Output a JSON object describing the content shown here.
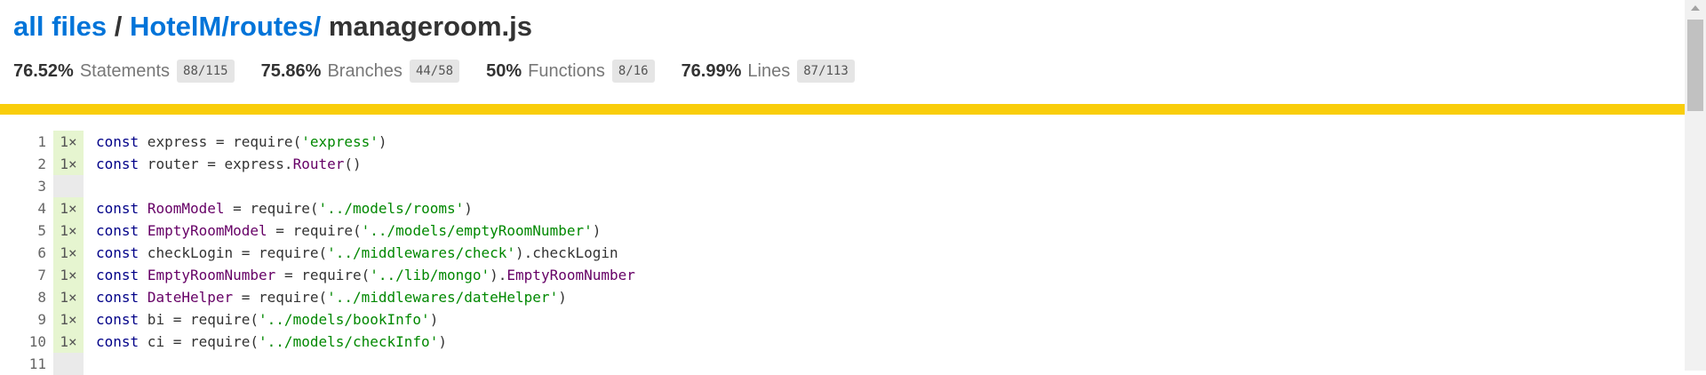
{
  "breadcrumb": {
    "all_files": "all files",
    "sep1": " / ",
    "dir": "HotelM/routes/",
    "file": " manageroom.js"
  },
  "stats": [
    {
      "pct": "76.52%",
      "label": "Statements",
      "frac": "88/115"
    },
    {
      "pct": "75.86%",
      "label": "Branches",
      "frac": "44/58"
    },
    {
      "pct": "50%",
      "label": "Functions",
      "frac": "8/16"
    },
    {
      "pct": "76.99%",
      "label": "Lines",
      "frac": "87/113"
    }
  ],
  "coverage_level": {
    "status": "medium",
    "bar_color": "#f9cd0b"
  },
  "code_lines": [
    {
      "num": "1",
      "count": "1×",
      "tokens": [
        [
          "kw",
          "const"
        ],
        [
          "p",
          " express = require("
        ],
        [
          "str",
          "'express'"
        ],
        [
          "p",
          ")"
        ]
      ]
    },
    {
      "num": "2",
      "count": "1×",
      "tokens": [
        [
          "kw",
          "const"
        ],
        [
          "p",
          " router = express."
        ],
        [
          "typ",
          "Router"
        ],
        [
          "p",
          "()"
        ]
      ]
    },
    {
      "num": "3",
      "count": "",
      "tokens": []
    },
    {
      "num": "4",
      "count": "1×",
      "tokens": [
        [
          "kw",
          "const"
        ],
        [
          "p",
          " "
        ],
        [
          "typ",
          "RoomModel"
        ],
        [
          "p",
          " = require("
        ],
        [
          "str",
          "'../models/rooms'"
        ],
        [
          "p",
          ")"
        ]
      ]
    },
    {
      "num": "5",
      "count": "1×",
      "tokens": [
        [
          "kw",
          "const"
        ],
        [
          "p",
          " "
        ],
        [
          "typ",
          "EmptyRoomModel"
        ],
        [
          "p",
          " = require("
        ],
        [
          "str",
          "'../models/emptyRoomNumber'"
        ],
        [
          "p",
          ")"
        ]
      ]
    },
    {
      "num": "6",
      "count": "1×",
      "tokens": [
        [
          "kw",
          "const"
        ],
        [
          "p",
          " checkLogin = require("
        ],
        [
          "str",
          "'../middlewares/check'"
        ],
        [
          "p",
          ").checkLogin"
        ]
      ]
    },
    {
      "num": "7",
      "count": "1×",
      "tokens": [
        [
          "kw",
          "const"
        ],
        [
          "p",
          " "
        ],
        [
          "typ",
          "EmptyRoomNumber"
        ],
        [
          "p",
          " = require("
        ],
        [
          "str",
          "'../lib/mongo'"
        ],
        [
          "p",
          ")."
        ],
        [
          "typ",
          "EmptyRoomNumber"
        ]
      ]
    },
    {
      "num": "8",
      "count": "1×",
      "tokens": [
        [
          "kw",
          "const"
        ],
        [
          "p",
          " "
        ],
        [
          "typ",
          "DateHelper"
        ],
        [
          "p",
          " = require("
        ],
        [
          "str",
          "'../middlewares/dateHelper'"
        ],
        [
          "p",
          ")"
        ]
      ]
    },
    {
      "num": "9",
      "count": "1×",
      "tokens": [
        [
          "kw",
          "const"
        ],
        [
          "p",
          " bi = require("
        ],
        [
          "str",
          "'../models/bookInfo'"
        ],
        [
          "p",
          ")"
        ]
      ]
    },
    {
      "num": "10",
      "count": "1×",
      "tokens": [
        [
          "kw",
          "const"
        ],
        [
          "p",
          " ci = require("
        ],
        [
          "str",
          "'../models/checkInfo'"
        ],
        [
          "p",
          ")"
        ]
      ]
    },
    {
      "num": "11",
      "count": "",
      "tokens": []
    }
  ]
}
